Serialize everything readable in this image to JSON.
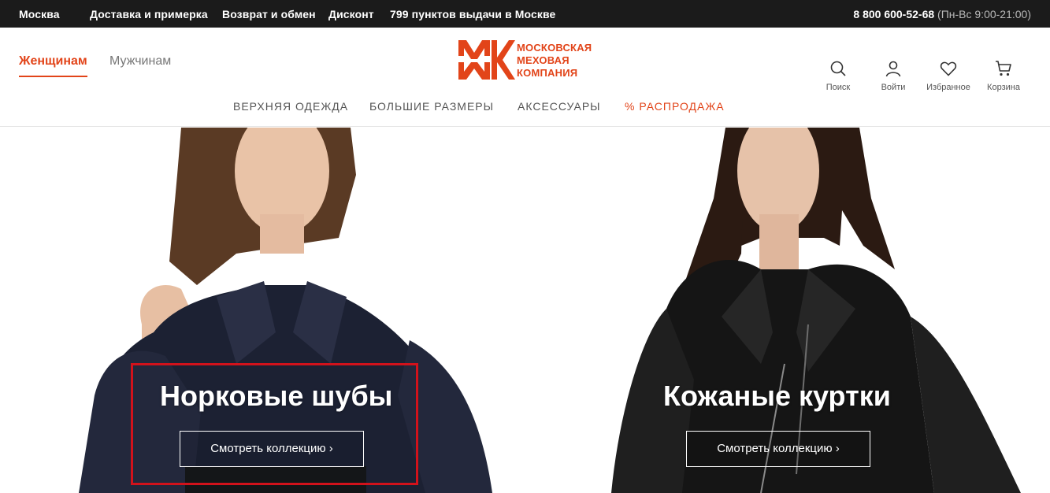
{
  "topbar": {
    "city": "Москва",
    "delivery": "Доставка и примерка",
    "returns": "Возврат и обмен",
    "discount": "Дисконт",
    "pickup": "799 пунктов выдачи в Москве",
    "phone": "8 800 600-52-68",
    "hours": "(Пн-Вс 9:00-21:00)"
  },
  "header": {
    "gender_women": "Женщинам",
    "gender_men": "Мужчинам",
    "logo_lines": [
      "МОСКОВСКАЯ",
      "МЕХОВАЯ",
      "КОМПАНИЯ"
    ],
    "nav": [
      "ВЕРХНЯЯ ОДЕЖДА",
      "БОЛЬШИЕ РАЗМЕРЫ",
      "АКСЕССУАРЫ",
      "% РАСПРОДАЖА"
    ],
    "utility": {
      "search": "Поиск",
      "login": "Войти",
      "favorites": "Избранное",
      "cart": "Корзина"
    }
  },
  "banners": [
    {
      "title": "Норковые шубы",
      "cta": "Смотреть коллекцию ›"
    },
    {
      "title": "Кожаные куртки",
      "cta": "Смотреть коллекцию ›"
    }
  ],
  "colors": {
    "accent": "#e24419",
    "topbar_bg": "#1b1b1b",
    "highlight": "#d2121b"
  }
}
